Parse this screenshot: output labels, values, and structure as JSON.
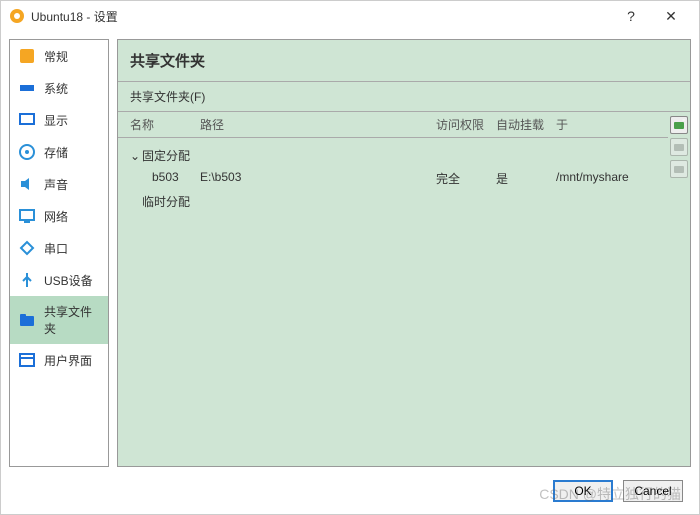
{
  "window": {
    "title": "Ubuntu18 - 设置",
    "help": "?",
    "close": "✕"
  },
  "sidebar": {
    "items": [
      {
        "label": "常规",
        "icon": "general-icon",
        "color": "#e8a02a"
      },
      {
        "label": "系统",
        "icon": "system-icon",
        "color": "#1b6fd8"
      },
      {
        "label": "显示",
        "icon": "display-icon",
        "color": "#1b6fd8"
      },
      {
        "label": "存储",
        "icon": "storage-icon",
        "color": "#2a90d8"
      },
      {
        "label": "声音",
        "icon": "audio-icon",
        "color": "#2a90d8"
      },
      {
        "label": "网络",
        "icon": "network-icon",
        "color": "#2a90d8"
      },
      {
        "label": "串口",
        "icon": "serial-icon",
        "color": "#2a90d8"
      },
      {
        "label": "USB设备",
        "icon": "usb-icon",
        "color": "#2a90d8"
      },
      {
        "label": "共享文件夹",
        "icon": "folder-icon",
        "color": "#1b6fd8",
        "selected": true
      },
      {
        "label": "用户界面",
        "icon": "ui-icon",
        "color": "#1b6fd8"
      }
    ]
  },
  "content": {
    "title": "共享文件夹",
    "section": "共享文件夹(F)",
    "columns": {
      "name": "名称",
      "path": "路径",
      "perm": "访问权限",
      "auto": "自动挂载",
      "at": "于"
    },
    "groups": {
      "fixed": "固定分配",
      "temp": "临时分配"
    },
    "rows": [
      {
        "name": "b503",
        "path": "E:\\b503",
        "perm": "完全",
        "auto": "是",
        "at": "/mnt/myshare"
      }
    ]
  },
  "footer": {
    "ok": "OK",
    "cancel": "Cancel"
  },
  "watermark": "CSDN @特立独行的猫"
}
